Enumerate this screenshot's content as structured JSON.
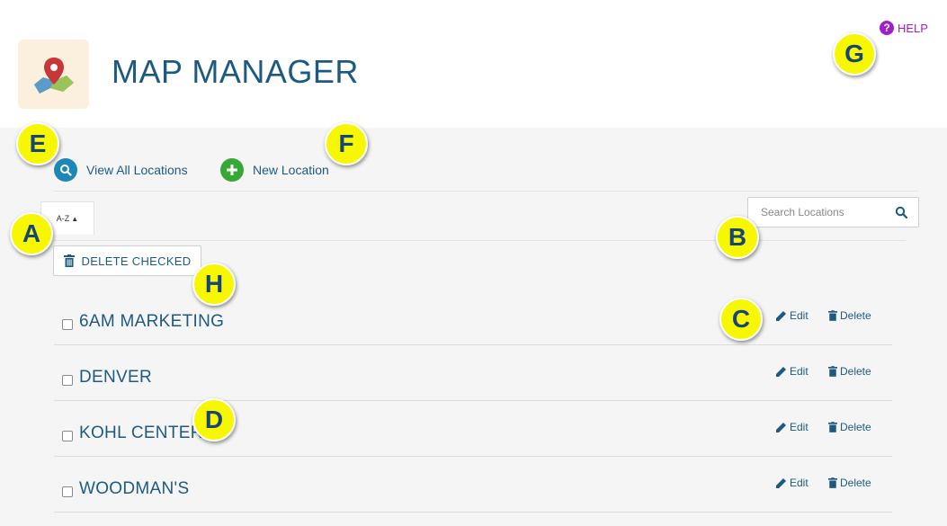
{
  "header": {
    "title": "MAP MANAGER",
    "app_icon": "map-pin-icon",
    "help_label": "HELP",
    "help_icon": "question-circle-icon"
  },
  "actions": {
    "view_all_label": "View All Locations",
    "view_all_icon": "search-circle-icon",
    "new_location_label": "New Location",
    "new_location_icon": "plus-circle-icon"
  },
  "toolbar": {
    "sort_label": "A-Z",
    "search_placeholder": "Search Locations",
    "delete_checked_label": "DELETE CHECKED"
  },
  "locations": [
    {
      "name": "6AM MARKETING",
      "edit_label": "Edit",
      "delete_label": "Delete",
      "checked": false
    },
    {
      "name": "DENVER",
      "edit_label": "Edit",
      "delete_label": "Delete",
      "checked": false
    },
    {
      "name": "KOHL CENTER",
      "edit_label": "Edit",
      "delete_label": "Delete",
      "checked": false
    },
    {
      "name": "WOODMAN'S",
      "edit_label": "Edit",
      "delete_label": "Delete",
      "checked": false
    }
  ],
  "callouts": {
    "a": "A",
    "b": "B",
    "c": "C",
    "d": "D",
    "e": "E",
    "f": "F",
    "g": "G",
    "h": "H"
  },
  "colors": {
    "primary_text": "#1d5a82",
    "help": "#a020c8",
    "view_all_icon": "#1d87b8",
    "new_location_icon": "#36a836",
    "callout_fill": "#f7f700",
    "page_background": "#f5f5f5"
  }
}
